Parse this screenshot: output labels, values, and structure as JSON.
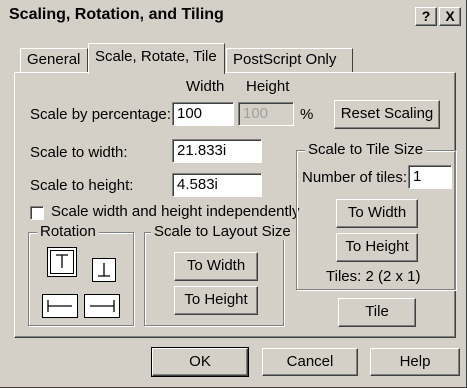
{
  "window": {
    "title": "Scaling, Rotation, and Tiling",
    "help_glyph": "?",
    "close_glyph": "X"
  },
  "tabs": [
    {
      "label": "General"
    },
    {
      "label": "Scale, Rotate, Tile"
    },
    {
      "label": "PostScript Only"
    }
  ],
  "scale": {
    "col_width": "Width",
    "col_height": "Height",
    "by_percentage_label": "Scale by percentage:",
    "width_value": "100",
    "height_value": "100",
    "percent_sign": "%",
    "reset_button": "Reset Scaling",
    "to_width_label": "Scale to width:",
    "to_width_value": "21.833i",
    "to_height_label": "Scale to height:",
    "to_height_value": "4.583i",
    "independent_label": "Scale width and height independently"
  },
  "rotation": {
    "title": "Rotation"
  },
  "layout": {
    "title": "Scale to Layout Size",
    "to_width": "To Width",
    "to_height": "To Height"
  },
  "tile": {
    "title": "Scale to Tile Size",
    "num_label": "Number of tiles:",
    "num_value": "1",
    "to_width": "To Width",
    "to_height": "To Height",
    "tiles_info": "Tiles: 2 (2 x 1)",
    "tile_button": "Tile"
  },
  "footer": {
    "ok": "OK",
    "cancel": "Cancel",
    "help": "Help"
  }
}
